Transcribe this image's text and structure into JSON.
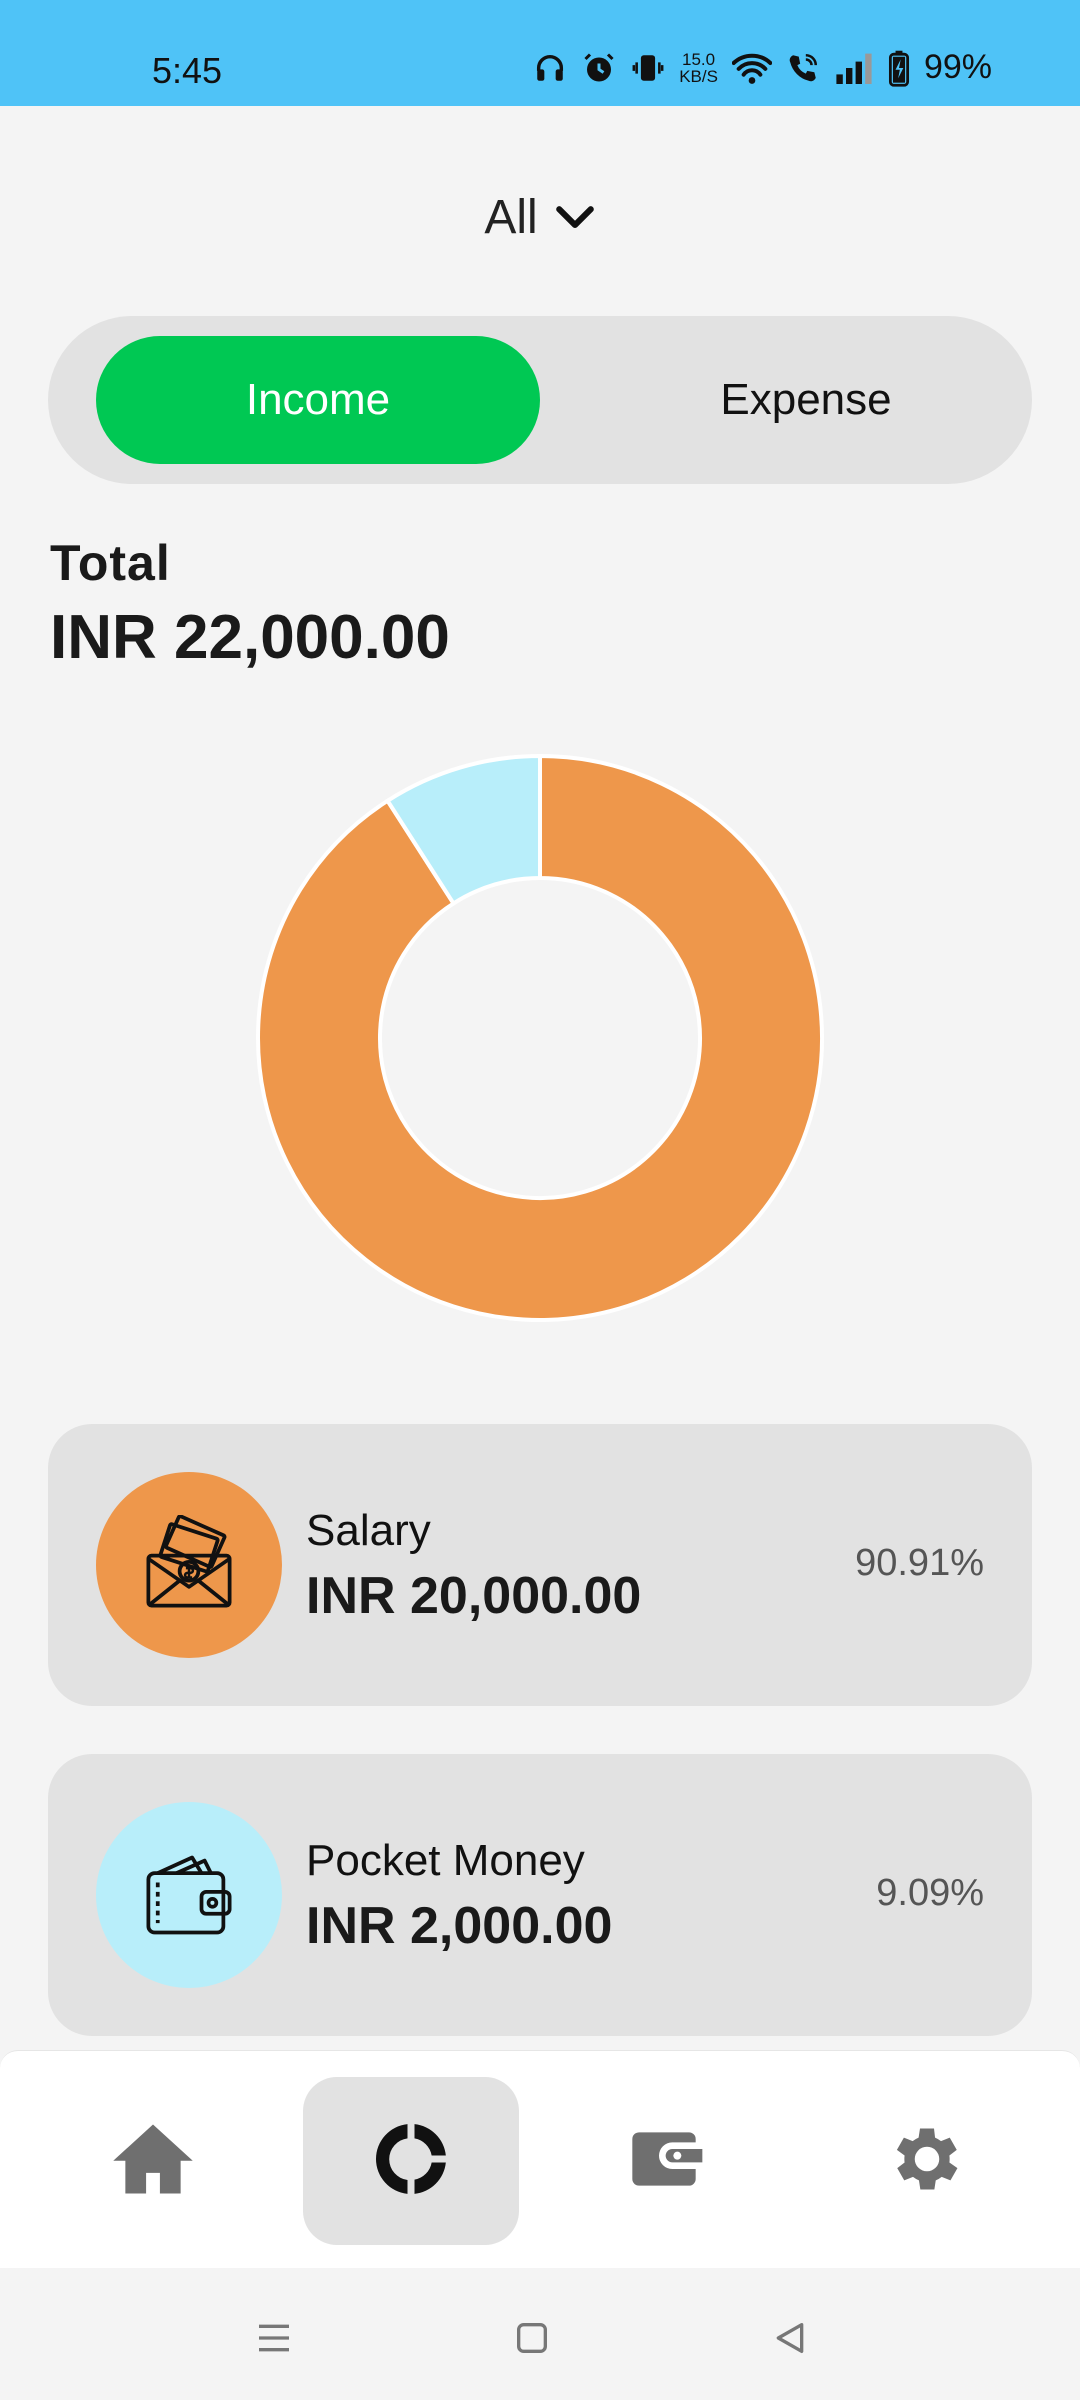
{
  "status_bar": {
    "time": "5:45",
    "net_speed_value": "15.0",
    "net_speed_unit": "KB/S",
    "battery": "99%",
    "icons": [
      "headphones-icon",
      "alarm-icon",
      "vibrate-icon",
      "wifi-icon",
      "wifi-call-icon",
      "signal-icon",
      "battery-charging-icon"
    ]
  },
  "filter": {
    "selected": "All",
    "icon": "chevron-down-icon"
  },
  "type_toggle": {
    "income_label": "Income",
    "expense_label": "Expense",
    "active": "Income",
    "active_color": "#00c853"
  },
  "summary": {
    "total_label": "Total",
    "total_value": "INR 22,000.00"
  },
  "chart_data": {
    "type": "pie",
    "categories": [
      "Salary",
      "Pocket Money"
    ],
    "values": [
      90.91,
      9.09
    ],
    "colors": [
      "#ee974b",
      "#b8eefa"
    ]
  },
  "categories": [
    {
      "name": "Salary",
      "amount": "INR 20,000.00",
      "percent": "90.91%",
      "color": "#ee974b",
      "icon": "money-envelope-icon"
    },
    {
      "name": "Pocket Money",
      "amount": "INR 2,000.00",
      "percent": "9.09%",
      "color": "#b8eefa",
      "icon": "wallet-icon"
    }
  ],
  "bottom_nav": {
    "active": "stats",
    "items": [
      {
        "key": "home",
        "icon": "home-icon"
      },
      {
        "key": "stats",
        "icon": "donut-chart-icon"
      },
      {
        "key": "wallet",
        "icon": "wallet-icon"
      },
      {
        "key": "settings",
        "icon": "gear-icon"
      }
    ]
  },
  "system_nav": {
    "icons": [
      "menu-icon",
      "home-square-icon",
      "back-icon"
    ]
  }
}
